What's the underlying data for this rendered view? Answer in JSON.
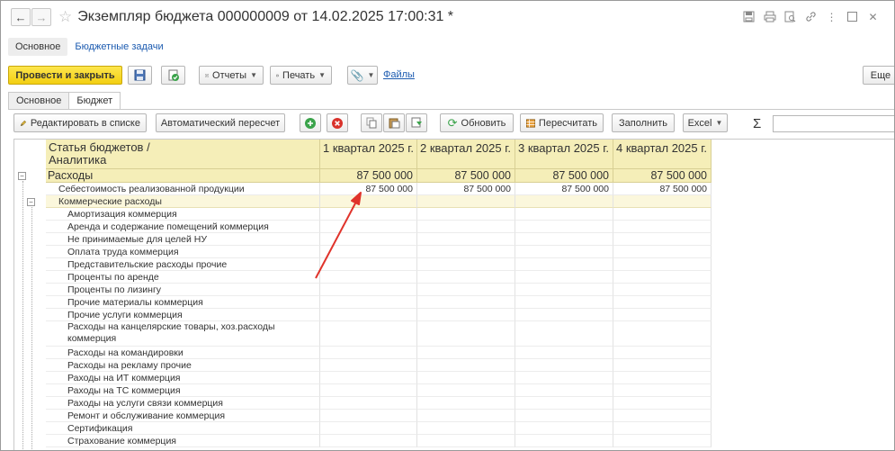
{
  "window": {
    "title": "Экземпляр бюджета 000000009 от 14.02.2025 17:00:31 *"
  },
  "section_tabs": {
    "active": "Основное",
    "link": "Бюджетные задачи"
  },
  "toolbar": {
    "post_close": "Провести и закрыть",
    "reports": "Отчеты",
    "print": "Печать",
    "files": "Файлы",
    "more": "Еще"
  },
  "form_tabs": [
    "Основное",
    "Бюджет"
  ],
  "table_toolbar": {
    "edit_list": "Редактировать в списке",
    "auto_recalc": "Автоматический пересчет",
    "refresh": "Обновить",
    "recalc": "Пересчитать",
    "fill": "Заполнить",
    "excel": "Excel",
    "sigma": "Σ"
  },
  "grid": {
    "headers": [
      "Статья бюджетов / Аналитика",
      "1 квартал 2025 г.",
      "2 квартал 2025 г.",
      "3 квартал 2025 г.",
      "4 квартал 2025 г."
    ],
    "rows": [
      {
        "name": "Расходы",
        "level": 0,
        "values": [
          "87 500 000",
          "87 500 000",
          "87 500 000",
          "87 500 000"
        ]
      },
      {
        "name": "Себестоимость реализованной продукции",
        "level": 1,
        "values": [
          "87 500 000",
          "87 500 000",
          "87 500 000",
          "87 500 000"
        ]
      },
      {
        "name": "Коммерческие расходы",
        "level": 1,
        "values": [
          "",
          "",
          "",
          ""
        ]
      },
      {
        "name": "Амортизация коммерция",
        "level": 2,
        "values": [
          "",
          "",
          "",
          ""
        ]
      },
      {
        "name": "Аренда и содержание помещений коммерция",
        "level": 2,
        "values": [
          "",
          "",
          "",
          ""
        ]
      },
      {
        "name": "Не принимаемые для целей НУ",
        "level": 2,
        "values": [
          "",
          "",
          "",
          ""
        ]
      },
      {
        "name": "Оплата труда коммерция",
        "level": 2,
        "values": [
          "",
          "",
          "",
          ""
        ]
      },
      {
        "name": "Представительские расходы прочие",
        "level": 2,
        "values": [
          "",
          "",
          "",
          ""
        ]
      },
      {
        "name": "Проценты по аренде",
        "level": 2,
        "values": [
          "",
          "",
          "",
          ""
        ]
      },
      {
        "name": "Проценты по лизингу",
        "level": 2,
        "values": [
          "",
          "",
          "",
          ""
        ]
      },
      {
        "name": "Прочие материалы коммерция",
        "level": 2,
        "values": [
          "",
          "",
          "",
          ""
        ]
      },
      {
        "name": "Прочие услуги коммерция",
        "level": 2,
        "values": [
          "",
          "",
          "",
          ""
        ]
      },
      {
        "name": "Расходы на канцелярские товары, хоз.расходы",
        "name2": "коммерция",
        "level": 2,
        "values": [
          "",
          "",
          "",
          ""
        ]
      },
      {
        "name": "Расходы на командировки",
        "level": 2,
        "values": [
          "",
          "",
          "",
          ""
        ]
      },
      {
        "name": "Расходы на рекламу прочие",
        "level": 2,
        "values": [
          "",
          "",
          "",
          ""
        ]
      },
      {
        "name": "Раходы на ИТ коммерция",
        "level": 2,
        "values": [
          "",
          "",
          "",
          ""
        ]
      },
      {
        "name": "Раходы на ТС коммерция",
        "level": 2,
        "values": [
          "",
          "",
          "",
          ""
        ]
      },
      {
        "name": "Раходы на услуги связи коммерция",
        "level": 2,
        "values": [
          "",
          "",
          "",
          ""
        ]
      },
      {
        "name": "Ремонт и обслуживание коммерция",
        "level": 2,
        "values": [
          "",
          "",
          "",
          ""
        ]
      },
      {
        "name": "Сертификация",
        "level": 2,
        "values": [
          "",
          "",
          "",
          ""
        ]
      },
      {
        "name": "Страхование коммерция",
        "level": 2,
        "values": [
          "",
          "",
          "",
          ""
        ]
      }
    ]
  },
  "colors": {
    "primary_button": "#f3cf12",
    "header_bg": "#f5eeb8",
    "link": "#1c5bb0",
    "annotation_arrow": "#e0332b"
  }
}
